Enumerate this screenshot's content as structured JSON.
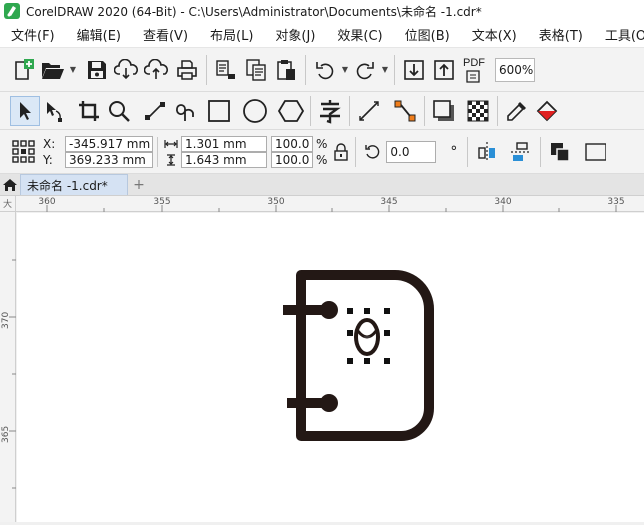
{
  "window": {
    "title": "CorelDRAW 2020 (64-Bit) - C:\\Users\\Administrator\\Documents\\未命名 -1.cdr*"
  },
  "menu": [
    {
      "label": "文件(F)",
      "name": "menu-file"
    },
    {
      "label": "编辑(E)",
      "name": "menu-edit"
    },
    {
      "label": "查看(V)",
      "name": "menu-view"
    },
    {
      "label": "布局(L)",
      "name": "menu-layout"
    },
    {
      "label": "对象(J)",
      "name": "menu-object"
    },
    {
      "label": "效果(C)",
      "name": "menu-effects"
    },
    {
      "label": "位图(B)",
      "name": "menu-bitmaps"
    },
    {
      "label": "文本(X)",
      "name": "menu-text"
    },
    {
      "label": "表格(T)",
      "name": "menu-table"
    },
    {
      "label": "工具(O)",
      "name": "menu-tools"
    }
  ],
  "standard_toolbar": {
    "pdf_label": "PDF",
    "zoom": "600%"
  },
  "property_bar": {
    "x_label": "X:",
    "y_label": "Y:",
    "x_value": "-345.917 mm",
    "y_value": "369.233 mm",
    "width_value": "1.301 mm",
    "height_value": "1.643 mm",
    "scale_w": "100.0",
    "scale_h": "100.0",
    "percent": "%",
    "rotation": "0.0",
    "degree": "°"
  },
  "tabs": {
    "document": "未命名 -1.cdr*",
    "add": "+"
  },
  "ruler": {
    "h_ticks": [
      "360",
      "355",
      "350",
      "345",
      "340",
      "335"
    ],
    "v_ticks": [
      "370",
      "365"
    ],
    "corner": "大"
  },
  "colors": {
    "accent": "#1e8a3a",
    "selection": "#dbe8f6",
    "drawing": "#231815",
    "orange": "#f07d1a"
  }
}
